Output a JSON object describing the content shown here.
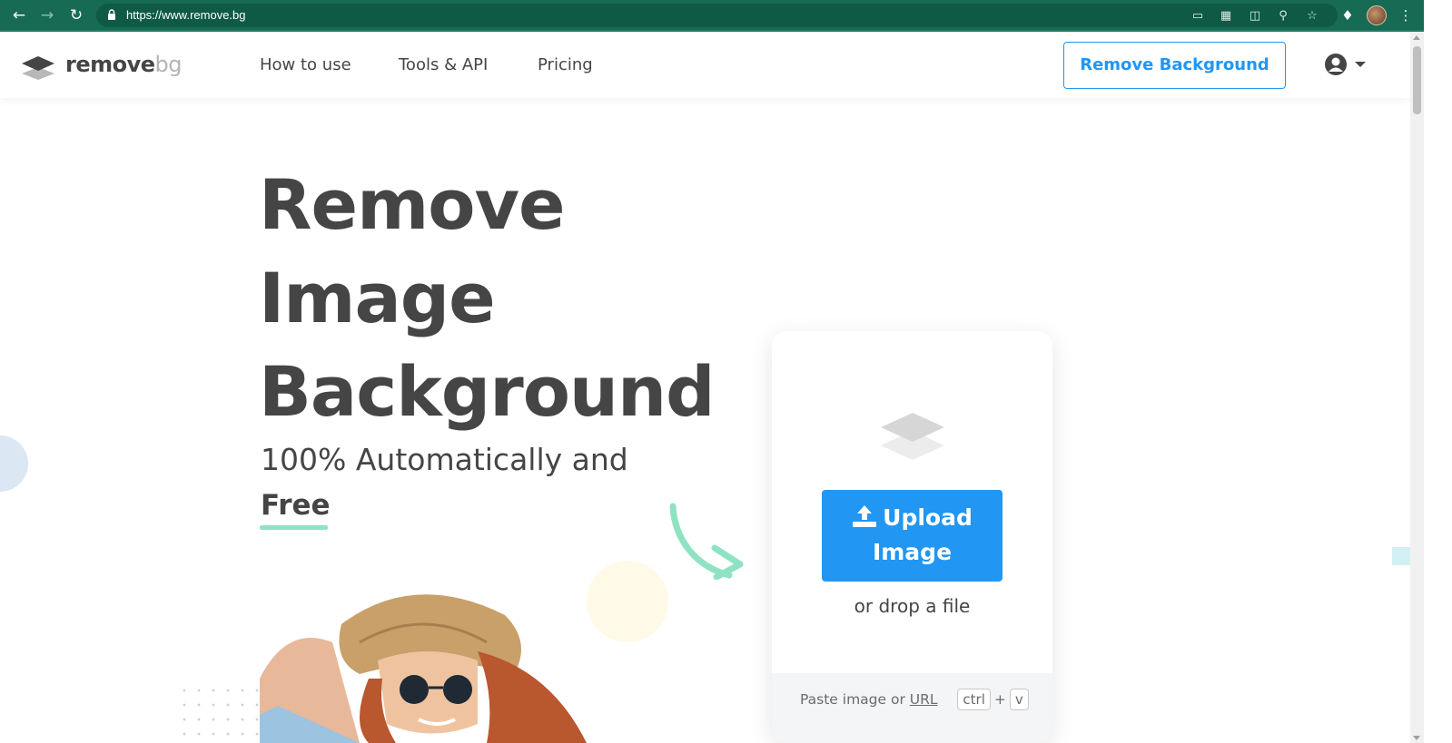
{
  "browser": {
    "url": "https://www.remove.bg",
    "icons": [
      "back-icon",
      "forward-icon",
      "reload-icon",
      "lock-icon",
      "cast-icon",
      "qr-icon",
      "translate-icon",
      "zoom-icon",
      "star-icon",
      "extensions-icon",
      "profile-icon",
      "menu-icon"
    ]
  },
  "header": {
    "logo": {
      "main": "remove",
      "suffix": "bg"
    },
    "nav": [
      "How to use",
      "Tools & API",
      "Pricing"
    ],
    "cta_label": "Remove Background"
  },
  "hero": {
    "title_lines": [
      "Remove",
      "Image",
      "Background"
    ],
    "subtitle": "100% Automatically and",
    "highlight": "Free"
  },
  "upload": {
    "button_line1": "Upload",
    "button_line2": "Image",
    "drop_text": "or drop a file",
    "paste_prefix": "Paste image or",
    "paste_link": "URL",
    "key1": "ctrl",
    "plus": "+",
    "key2": "v"
  },
  "colors": {
    "chrome": "#176b54",
    "accent": "#2196f3",
    "text": "#454545",
    "highlight_underline": "#8fe3c2"
  }
}
